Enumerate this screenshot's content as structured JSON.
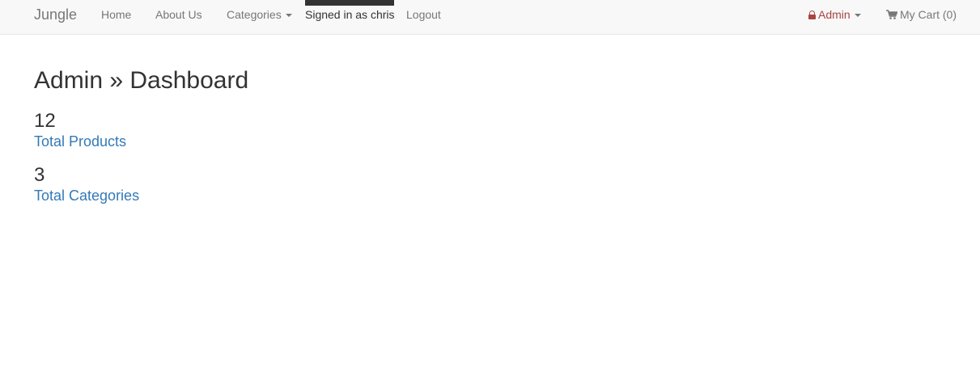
{
  "navbar": {
    "brand": "Jungle",
    "home": "Home",
    "about": "About Us",
    "categories": "Categories",
    "signed_in": "Signed in as chris",
    "logout": "Logout",
    "admin": "Admin",
    "cart": "My Cart (0)"
  },
  "page": {
    "title": "Admin » Dashboard",
    "stats": [
      {
        "value": "12",
        "label": "Total Products"
      },
      {
        "value": "3",
        "label": "Total Categories"
      }
    ]
  },
  "colors": {
    "navbar_bg": "#f8f8f8",
    "link": "#337ab7",
    "admin": "#a94442",
    "nav_text": "#777777"
  },
  "icons": {
    "admin": "lock-icon",
    "cart": "shopping-cart-icon",
    "dropdown": "caret-down-icon"
  }
}
